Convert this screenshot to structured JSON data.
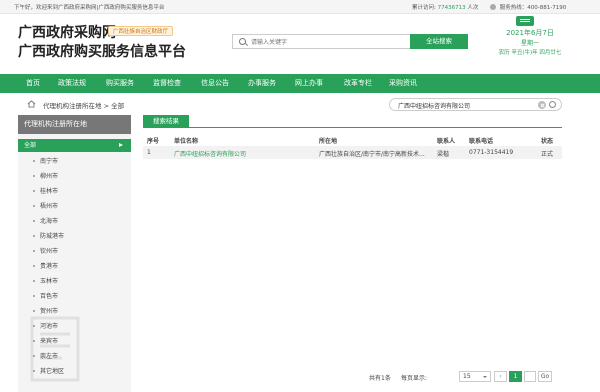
{
  "topbar": {
    "greeting": "下午好，欢迎来到广西政府采购网|广西政府购买服务信息平台",
    "visits_label": "累计访问:",
    "visits_count": "77436713",
    "visits_unit": "人次",
    "hotline": "服务热线：400-881-7190"
  },
  "header": {
    "title_line1": "广西政府采购网",
    "tag": "广西壮族自治区财政厅",
    "title_line2": "广西政府购买服务信息平台",
    "search_placeholder": "请输入关键字",
    "search_button": "全站搜索",
    "date": "2021年6月7日",
    "weekday": "星期一",
    "lunar": "农历 辛丑(牛)年 四月廿七"
  },
  "nav": [
    "首页",
    "政策法规",
    "购买服务",
    "监督检查",
    "信息公告",
    "办事服务",
    "网上办事",
    "改革专栏",
    "采购资讯"
  ],
  "breadcrumb": "代理机构注册所在地 > 全部",
  "filter": {
    "value": "广西中纽招标咨询有限公司"
  },
  "sidebar": {
    "title": "代理机构注册所在地",
    "items": [
      "全部",
      "南宁市",
      "柳州市",
      "桂林市",
      "梧州市",
      "北海市",
      "防城港市",
      "钦州市",
      "贵港市",
      "玉林市",
      "百色市",
      "贺州市",
      "河池市",
      "来宾市",
      "崇左市",
      "其它地区"
    ]
  },
  "results": {
    "tab_label": "搜索结果",
    "headers": {
      "seq": "序号",
      "unit": "单位名称",
      "addr": "所在地",
      "contact": "联系人",
      "phone": "联系电话",
      "status": "状态"
    },
    "rows": [
      {
        "seq": "1",
        "unit": "广西中纽招标咨询有限公司",
        "addr": "广西壮族自治区/南宁市/南宁高新技术...",
        "contact": "梁楷",
        "phone": "0771-3154419",
        "status": "正式"
      }
    ]
  },
  "pager": {
    "total": "共有1条",
    "per_page_label": "每页显示:",
    "per_page": "15",
    "prev": "‹",
    "current": "1",
    "next": "›",
    "go": "Go"
  },
  "colors": {
    "brand_green": "#2aa15a",
    "sidebar_title": "#777777"
  }
}
